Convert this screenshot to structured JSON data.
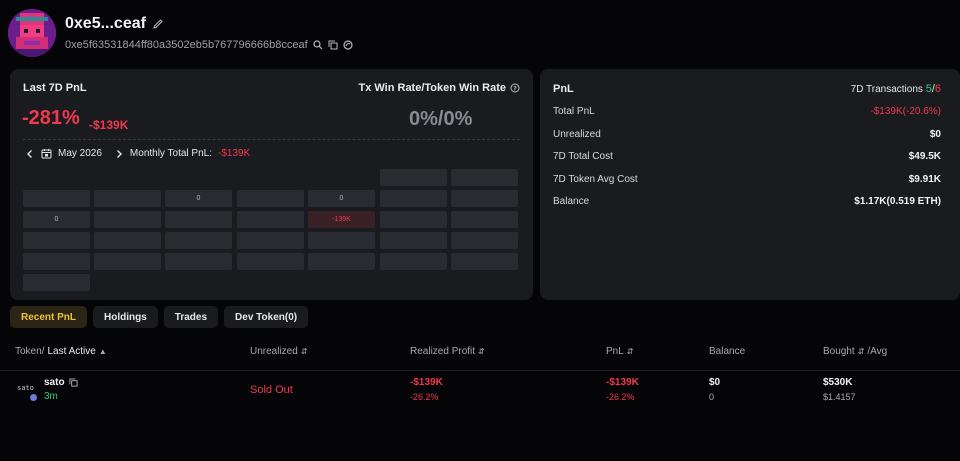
{
  "wallet": {
    "short_name": "0xe5...ceaf",
    "address": "0xe5f63531844ff80a3502eb5b767796666b8cceaf"
  },
  "pnl_card": {
    "title": "Last 7D PnL",
    "pnl_percent": "-281%",
    "pnl_usd": "-$139K",
    "win_rate_title": "Tx Win Rate/Token Win Rate",
    "win_rate_value": "0%/0%",
    "month": "May 2026",
    "monthly_total_label": "Monthly Total PnL:",
    "monthly_total_value": "-$139K",
    "calendar_labels": {
      "c1": "0",
      "c2": "0",
      "c3": "0",
      "c4": "-139K"
    }
  },
  "summary": {
    "title": "PnL",
    "tx_label": "7D Transactions",
    "tx_wins": "5",
    "tx_sep": "/",
    "tx_losses": "6",
    "rows": [
      {
        "label": "Total PnL",
        "value": "-$139K(-20.6%)"
      },
      {
        "label": "Unrealized",
        "value": "$0"
      },
      {
        "label": "7D Total Cost",
        "value": "$49.5K"
      },
      {
        "label": "7D Token Avg Cost",
        "value": "$9.91K"
      },
      {
        "label": "Balance",
        "value": "$1.17K(0.519 ETH)"
      }
    ]
  },
  "tabs": [
    "Recent PnL",
    "Holdings",
    "Trades",
    "Dev Token(0)"
  ],
  "table": {
    "headers": {
      "token_a": "Token/",
      "token_b": "Last Active",
      "unrealized": "Unrealized",
      "realized": "Realized Profit",
      "pnl": "PnL",
      "balance": "Balance",
      "bought": "Bought",
      "avg": "/Avg"
    },
    "rows": [
      {
        "token_icon_text": "sato",
        "token": "sato",
        "last_active": "3m",
        "unrealized": "Sold Out",
        "realized_usd": "-$139K",
        "realized_pct": "-26.2%",
        "pnl_usd": "-$139K",
        "pnl_pct": "-26.2%",
        "balance_usd": "$0",
        "balance_amt": "0",
        "bought_usd": "$530K",
        "avg_price": "$1.4157"
      }
    ]
  },
  "colors": {
    "negative": "#f0394e",
    "positive": "#2fd08a",
    "accent_tab": "#f0c23a"
  }
}
